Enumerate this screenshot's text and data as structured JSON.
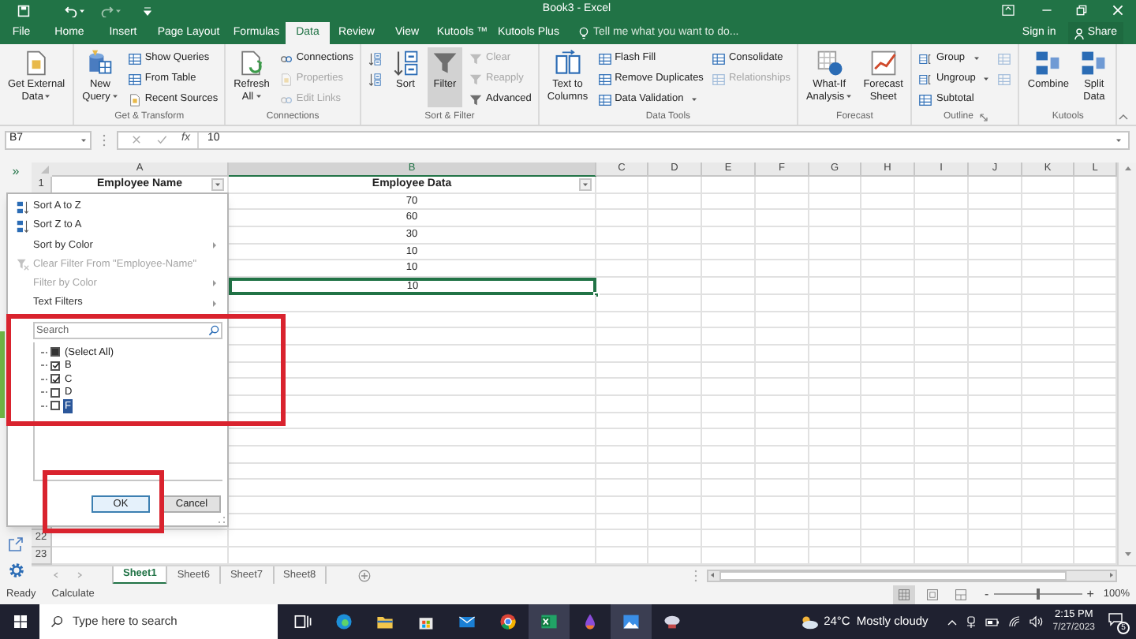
{
  "title_bar": {
    "title": "Book3 - Excel"
  },
  "ribbon_tabs": [
    {
      "label": "File",
      "selected": false
    },
    {
      "label": "Home",
      "selected": false
    },
    {
      "label": "Insert",
      "selected": false
    },
    {
      "label": "Page Layout",
      "selected": false
    },
    {
      "label": "Formulas",
      "selected": false
    },
    {
      "label": "Data",
      "selected": true
    },
    {
      "label": "Review",
      "selected": false
    },
    {
      "label": "View",
      "selected": false
    },
    {
      "label": "Kutools ™",
      "selected": false
    },
    {
      "label": "Kutools Plus",
      "selected": false
    }
  ],
  "tell_me": {
    "placeholder": "Tell me what you want to do..."
  },
  "account": {
    "sign_in": "Sign in",
    "share": "Share"
  },
  "ribbon_groups": [
    {
      "launcher": false,
      "columns": [
        {
          "kind": "large",
          "buttons": [
            {
              "label": "Get External\nData",
              "dropdown": true,
              "disabled": false,
              "selected": false
            }
          ]
        }
      ]
    },
    {
      "label": "Get & Transform",
      "launcher": false,
      "columns": [
        {
          "kind": "large",
          "buttons": [
            {
              "label": "New\nQuery",
              "dropdown": true,
              "disabled": false,
              "selected": false
            }
          ]
        },
        {
          "kind": "small",
          "buttons": [
            {
              "label": "Show Queries",
              "dropdown": false,
              "disabled": false,
              "selected": false
            },
            {
              "label": "From Table",
              "dropdown": false,
              "disabled": false,
              "selected": false
            },
            {
              "label": "Recent Sources",
              "dropdown": false,
              "disabled": false,
              "selected": false
            }
          ]
        }
      ]
    },
    {
      "label": "Connections",
      "launcher": false,
      "columns": [
        {
          "kind": "large",
          "buttons": [
            {
              "label": "Refresh\nAll",
              "dropdown": true,
              "disabled": false,
              "selected": false
            }
          ]
        },
        {
          "kind": "small",
          "buttons": [
            {
              "label": "Connections",
              "dropdown": false,
              "disabled": false,
              "selected": false
            },
            {
              "label": "Properties",
              "dropdown": false,
              "disabled": true,
              "selected": false
            },
            {
              "label": "Edit Links",
              "dropdown": false,
              "disabled": true,
              "selected": false
            }
          ]
        }
      ]
    },
    {
      "label": "Sort & Filter",
      "launcher": false,
      "columns": [
        {
          "kind": "small",
          "buttons": [
            {
              "dropdown": false,
              "disabled": false,
              "selected": false
            },
            {
              "dropdown": false,
              "disabled": false,
              "selected": false
            }
          ]
        },
        {
          "kind": "large",
          "buttons": [
            {
              "label": "Sort",
              "dropdown": false,
              "disabled": false,
              "selected": false
            }
          ]
        },
        {
          "kind": "large",
          "buttons": [
            {
              "label": "Filter",
              "dropdown": false,
              "disabled": false,
              "selected": true
            }
          ]
        },
        {
          "kind": "small",
          "buttons": [
            {
              "label": "Clear",
              "dropdown": false,
              "disabled": true,
              "selected": false
            },
            {
              "label": "Reapply",
              "dropdown": false,
              "disabled": true,
              "selected": false
            },
            {
              "label": "Advanced",
              "dropdown": false,
              "disabled": false,
              "selected": false
            }
          ]
        }
      ]
    },
    {
      "label": "Data Tools",
      "launcher": false,
      "columns": [
        {
          "kind": "large",
          "buttons": [
            {
              "label": "Text to\nColumns",
              "dropdown": false,
              "disabled": false,
              "selected": false
            }
          ]
        },
        {
          "kind": "small",
          "buttons": [
            {
              "label": "Flash Fill",
              "dropdown": false,
              "disabled": false,
              "selected": false
            },
            {
              "label": "Remove Duplicates",
              "dropdown": false,
              "disabled": false,
              "selected": false
            },
            {
              "label": "Data Validation",
              "dropdown": true,
              "disabled": false,
              "selected": false
            }
          ]
        },
        {
          "kind": "small",
          "buttons": [
            {
              "label": "Consolidate",
              "dropdown": false,
              "disabled": false,
              "selected": false
            },
            {
              "label": "Relationships",
              "dropdown": false,
              "disabled": true,
              "selected": false
            }
          ]
        }
      ]
    },
    {
      "label": "Forecast",
      "launcher": false,
      "columns": [
        {
          "kind": "large",
          "buttons": [
            {
              "label": "What-If\nAnalysis",
              "dropdown": true,
              "disabled": false,
              "selected": false
            }
          ]
        },
        {
          "kind": "large",
          "buttons": [
            {
              "label": "Forecast\nSheet",
              "dropdown": false,
              "disabled": false,
              "selected": false
            }
          ]
        }
      ]
    },
    {
      "label": "Outline",
      "launcher": true,
      "columns": [
        {
          "kind": "small",
          "buttons": [
            {
              "label": "Group",
              "dropdown": true,
              "disabled": false,
              "selected": false
            },
            {
              "label": "Ungroup",
              "dropdown": true,
              "disabled": false,
              "selected": false
            },
            {
              "label": "Subtotal",
              "dropdown": false,
              "disabled": false,
              "selected": false
            }
          ]
        },
        {
          "kind": "small",
          "buttons": [
            {
              "dropdown": false,
              "disabled": true,
              "selected": false
            },
            {
              "dropdown": false,
              "disabled": true,
              "selected": false
            }
          ]
        }
      ]
    },
    {
      "label": "Kutools",
      "launcher": false,
      "columns": [
        {
          "kind": "large",
          "buttons": [
            {
              "label": "Combine",
              "dropdown": false,
              "disabled": false,
              "selected": false
            }
          ]
        },
        {
          "kind": "large",
          "buttons": [
            {
              "label": "Split\nData",
              "dropdown": false,
              "disabled": false,
              "selected": false
            }
          ]
        }
      ]
    }
  ],
  "formula_bar": {
    "name_box": "B7",
    "function_label": "fx",
    "value": "10"
  },
  "navigation_pane": {
    "expand": "»"
  },
  "sheet": {
    "columns": [
      {
        "label": "A",
        "selected": false
      },
      {
        "label": "B",
        "selected": true
      },
      {
        "label": "C",
        "selected": false
      },
      {
        "label": "D",
        "selected": false
      },
      {
        "label": "E",
        "selected": false
      },
      {
        "label": "F",
        "selected": false
      },
      {
        "label": "G",
        "selected": false
      },
      {
        "label": "H",
        "selected": false
      },
      {
        "label": "I",
        "selected": false
      },
      {
        "label": "J",
        "selected": false
      },
      {
        "label": "K",
        "selected": false
      },
      {
        "label": "L",
        "selected": false
      }
    ],
    "header_row": {
      "number": "1",
      "cells": [
        "Employee Name",
        "Employee Data"
      ]
    },
    "data_rows": [
      {
        "value": "70",
        "selected": false
      },
      {
        "value": "60",
        "selected": false
      },
      {
        "value": "30",
        "selected": false
      },
      {
        "value": "10",
        "selected": false
      },
      {
        "value": "10",
        "selected": false
      },
      {
        "value": "10",
        "selected": true
      }
    ],
    "bottom_row_numbers": [
      "22",
      "23"
    ]
  },
  "filter_menu": {
    "items": [
      {
        "label": "Sort A to Z",
        "disabled": false,
        "submenu": false
      },
      {
        "label": "Sort Z to A",
        "disabled": false,
        "submenu": false
      },
      {
        "label": "Sort by Color",
        "disabled": false,
        "submenu": true
      },
      {
        "label": "Clear Filter From \"Employee-Name\"",
        "disabled": true,
        "submenu": false
      },
      {
        "label": "Filter by Color",
        "disabled": true,
        "submenu": true
      },
      {
        "label": "Text Filters",
        "disabled": false,
        "submenu": true
      }
    ],
    "search": {
      "placeholder": "Search"
    },
    "values": [
      {
        "label": "(Select All)",
        "checked": false,
        "partial": true,
        "selected": false
      },
      {
        "label": "B",
        "checked": true,
        "partial": false,
        "selected": false
      },
      {
        "label": "C",
        "checked": true,
        "partial": false,
        "selected": false
      },
      {
        "label": "D",
        "checked": false,
        "partial": false,
        "selected": false
      },
      {
        "label": "F",
        "checked": false,
        "partial": false,
        "selected": true
      }
    ],
    "buttons": [
      {
        "label": "OK",
        "focused": true
      },
      {
        "label": "Cancel",
        "focused": false
      }
    ]
  },
  "sheet_tabs": [
    {
      "label": "Sheet1",
      "selected": true
    },
    {
      "label": "Sheet6",
      "selected": false
    },
    {
      "label": "Sheet7",
      "selected": false
    },
    {
      "label": "Sheet8",
      "selected": false
    }
  ],
  "status_bar": {
    "mode": "Ready",
    "calculate": "Calculate",
    "views": [
      {
        "selected": true
      },
      {
        "selected": false
      },
      {
        "selected": false
      }
    ],
    "zoom": {
      "minus": "-",
      "plus": "+",
      "level": 0.5,
      "reading": "100%"
    }
  },
  "taskbar": {
    "search": {
      "placeholder": "Type here to search"
    },
    "apps": [
      {
        "active": false
      },
      {
        "active": false
      },
      {
        "active": false
      },
      {
        "active": false
      },
      {
        "active": false
      },
      {
        "active": false
      },
      {
        "active": true
      },
      {
        "active": false
      },
      {
        "active": true
      },
      {
        "active": false
      }
    ],
    "weather": {
      "temperature": "24°C",
      "condition": "Mostly cloudy"
    },
    "clock": {
      "time": "2:15 PM",
      "date": "7/27/2023"
    },
    "notifications": "5"
  }
}
